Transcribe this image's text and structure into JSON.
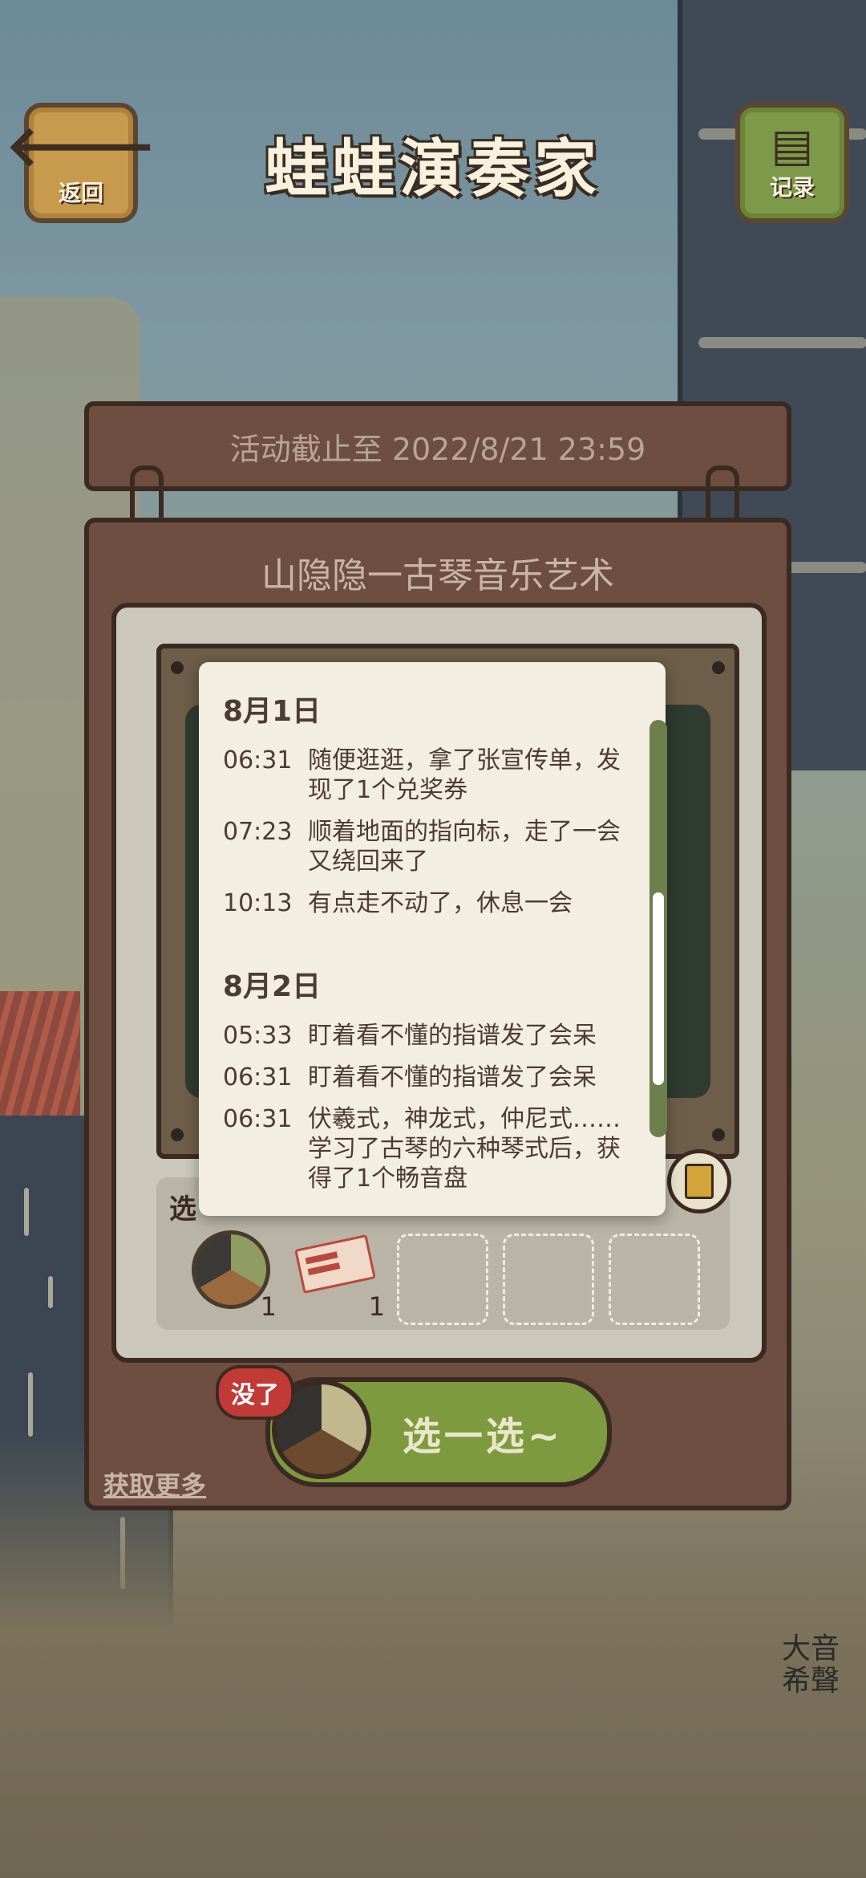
{
  "header": {
    "back_label": "返回",
    "title": "蛙蛙演奏家",
    "record_label": "记录"
  },
  "event": {
    "deadline": "活动截止至 2022/8/21 23:59",
    "title": "山隐隐一古琴音乐艺术"
  },
  "tray": {
    "label": "选",
    "items": [
      {
        "name": "compass",
        "count": "1"
      },
      {
        "name": "coupon",
        "count": "1"
      }
    ]
  },
  "play": {
    "badge": "没了",
    "label": "选一选~"
  },
  "get_more": "获取更多",
  "log": {
    "days": [
      {
        "date": "8月1日",
        "entries": [
          {
            "time": "06:31",
            "text": "随便逛逛，拿了张宣传单，发现了1个兑奖券"
          },
          {
            "time": "07:23",
            "text": "顺着地面的指向标，走了一会又绕回来了"
          },
          {
            "time": "10:13",
            "text": "有点走不动了，休息一会"
          }
        ]
      },
      {
        "date": "8月2日",
        "entries": [
          {
            "time": "05:33",
            "text": "盯着看不懂的指谱发了会呆"
          },
          {
            "time": "06:31",
            "text": "盯着看不懂的指谱发了会呆"
          },
          {
            "time": "06:31",
            "text": "伏羲式，神龙式，仲尼式……学习了古琴的六种琴式后，获得了1个畅音盘"
          }
        ]
      }
    ]
  },
  "watermark": "大音希聲",
  "colors": {
    "wood": "#6e4e40",
    "outline": "#3b2a22",
    "accent_green": "#7d9a3f",
    "badge_red": "#c23a36",
    "log_bg": "#f3eee1"
  },
  "icons": {
    "back": "arrow-left-icon",
    "record": "calendar-icon",
    "log_toggle": "document-icon"
  }
}
